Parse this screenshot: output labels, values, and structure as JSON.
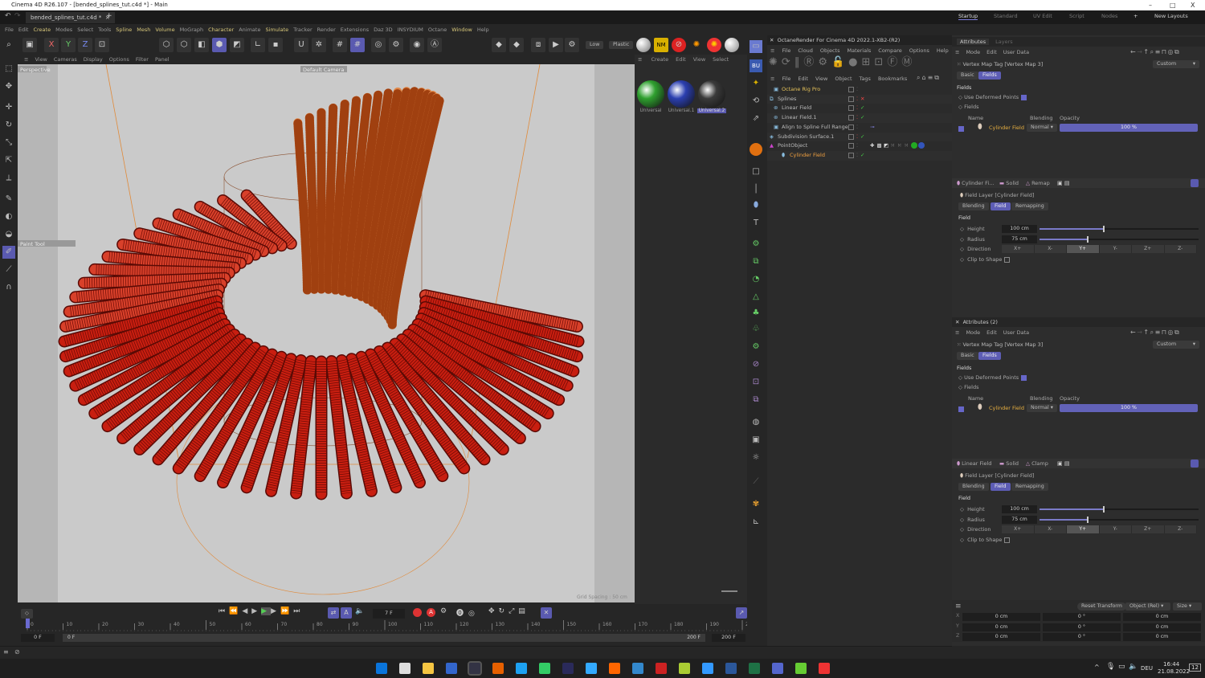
{
  "window": {
    "title": "Cinema 4D R26.107 - [bended_splines_tut.c4d *] - Main",
    "min": "–",
    "max": "□",
    "close": "X"
  },
  "tabs": {
    "document": "bended_splines_tut.c4d *",
    "close": "×",
    "add": "+"
  },
  "layouts": {
    "items": [
      "Startup",
      "Standard",
      "UV Edit",
      "Script",
      "Nodes"
    ],
    "add": "+",
    "new_layouts": "New Layouts"
  },
  "menu": [
    "File",
    "Edit",
    "Create",
    "Modes",
    "Select",
    "Tools",
    "Spline",
    "Mesh",
    "Volume",
    "MoGraph",
    "Character",
    "Animate",
    "Simulate",
    "Tracker",
    "Render",
    "Extensions",
    "Daz 3D",
    "INSYDIUM",
    "Octane",
    "Window",
    "Help"
  ],
  "menu_highlight": [
    "Create",
    "Spline",
    "Mesh",
    "Volume",
    "Character",
    "Simulate",
    "Window"
  ],
  "toolbar": {
    "axis_x": "X",
    "axis_y": "Y",
    "axis_z": "Z",
    "quality_low": "Low",
    "quality_plastic": "Plastic"
  },
  "viewport": {
    "menu": [
      "View",
      "Cameras",
      "Display",
      "Options",
      "Filter",
      "Panel"
    ],
    "name": "Perspective",
    "camera": "Default Camera",
    "tool": "Paint Tool",
    "grid": "Grid Spacing : 50 cm",
    "bg": "#c9c9c9",
    "tube_color": "#c81e10",
    "tube_back_color": "#e0884a"
  },
  "materials": {
    "menu": [
      "Create",
      "Edit",
      "View",
      "Select"
    ],
    "items": [
      {
        "name": "Universal",
        "color": "#2fa02f"
      },
      {
        "name": "Universal.1",
        "color": "#2b3fb0"
      },
      {
        "name": "Universal.2",
        "color": "#3a3a3a",
        "selected": true
      }
    ]
  },
  "octane": {
    "title": "OctaneRender For Cinema 4D 2022.1-XB2-(R2)",
    "menu": [
      "File",
      "Cloud",
      "Objects",
      "Materials",
      "Compare",
      "Options",
      "Help",
      "GUI"
    ]
  },
  "objects": {
    "menu": [
      "File",
      "Edit",
      "View",
      "Object",
      "Tags",
      "Bookmarks"
    ],
    "items": [
      {
        "name": "Octane Rig Pro",
        "color": "#e5c25a",
        "status": ""
      },
      {
        "name": "Splines",
        "color": "#bbbbbb",
        "status": "✕"
      },
      {
        "name": "Linear Field",
        "color": "#bbbbbb",
        "status": "✓"
      },
      {
        "name": "Linear Field.1",
        "color": "#bbbbbb",
        "status": "✓"
      },
      {
        "name": "Align to Spline Full Range",
        "color": "#bbbbbb",
        "status": ""
      },
      {
        "name": "Subdivision Surface.1",
        "color": "#bbbbbb",
        "status": "✓"
      },
      {
        "name": "PointObject",
        "color": "#bbbbbb",
        "status": ""
      },
      {
        "name": "Cylinder Field",
        "color": "#f0a040",
        "status": "✓"
      }
    ]
  },
  "attributes": {
    "tabs": [
      "Attributes",
      "Layers"
    ],
    "second_title": "Attributes (2)",
    "menu": [
      "Mode",
      "Edit",
      "User Data"
    ],
    "tag": "Vertex Map Tag [Vertex Map 3]",
    "preset": "Custom",
    "subtabs": [
      "Basic",
      "Fields"
    ],
    "section": "Fields",
    "use_deformed": "Use Deformed Points",
    "fields_label": "Fields",
    "cols": [
      "Name",
      "Blending",
      "Opacity"
    ],
    "field_name": "Cylinder Field",
    "blending": "Normal",
    "opacity": "100 %",
    "opacity_value": 100,
    "layer_tabs1": [
      "Cylinder Fi...",
      "Solid",
      "Remap"
    ],
    "layer_tabs2": [
      "Linear Field",
      "Solid",
      "Clamp"
    ],
    "layer_title": "Field Layer [Cylinder Field]",
    "layer_subtabs": [
      "Blending",
      "Field",
      "Remapping"
    ],
    "field_section": "Field",
    "height_label": "Height",
    "height": "100 cm",
    "height_fraction": 0.08,
    "radius_label": "Radius",
    "radius": "75 cm",
    "radius_fraction": 0.06,
    "direction_label": "Direction",
    "directions": [
      "X+",
      "X-",
      "Y+",
      "Y-",
      "Z+",
      "Z-"
    ],
    "direction_selected": "Y+",
    "clip_label": "Clip to Shape"
  },
  "coords": {
    "reset": "Reset Transform",
    "mode": "Object (Rel)",
    "size": "Size",
    "axes": [
      "X",
      "Y",
      "Z"
    ],
    "pos": "0 cm",
    "rot": "0 °",
    "scl": "0 cm"
  },
  "timeline": {
    "current": "7 F",
    "ticks": [
      "0",
      "10",
      "20",
      "30",
      "40",
      "50",
      "60",
      "70",
      "80",
      "90",
      "100",
      "110",
      "120",
      "130",
      "140",
      "150",
      "160",
      "170",
      "180",
      "190",
      "200"
    ],
    "start": "0 F",
    "range_start": "0 F",
    "range_end": "200 F",
    "end": "200 F"
  },
  "taskbar": {
    "lang": "DEU",
    "time": "16:44",
    "date": "21.08.2022",
    "notifications": "12"
  }
}
